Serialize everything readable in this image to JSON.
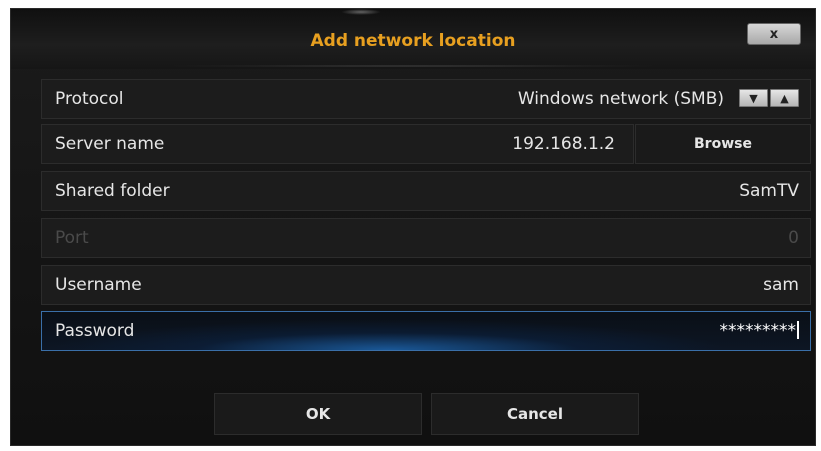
{
  "dialog": {
    "title": "Add network location",
    "close_label": "x"
  },
  "fields": [
    {
      "label": "Protocol",
      "value": "Windows network (SMB)",
      "enabled": true
    },
    {
      "label": "Server name",
      "value": "192.168.1.2",
      "enabled": true
    },
    {
      "label": "Shared folder",
      "value": "SamTV",
      "enabled": true
    },
    {
      "label": "Port",
      "value": "0",
      "enabled": false
    },
    {
      "label": "Username",
      "value": "sam",
      "enabled": true
    },
    {
      "label": "Password",
      "value": "*********",
      "enabled": true,
      "focused": true
    }
  ],
  "protocol_spinner": {
    "down_icon": "triangle-down-icon",
    "up_icon": "triangle-up-icon",
    "down_glyph": "▼",
    "up_glyph": "▲"
  },
  "buttons": {
    "browse_label": "Browse",
    "ok_label": "OK",
    "cancel_label": "Cancel"
  },
  "colors": {
    "title_accent": "#e8a020",
    "focus_blue": "#1e6ebe",
    "background": "#141414"
  }
}
